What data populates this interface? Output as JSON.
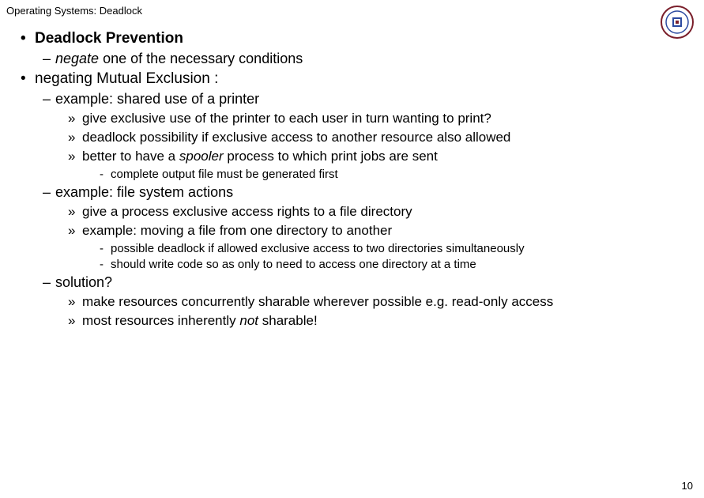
{
  "header": "Operating Systems: Deadlock",
  "slide": {
    "l1a": "Deadlock Prevention",
    "l2a_pre": "negate",
    "l2a_post": " one of the necessary conditions",
    "l1b": "negating Mutual Exclusion :",
    "l2b": "example: shared use of a printer",
    "l3a": "give exclusive use of the printer to each user in turn wanting to print?",
    "l3b": "deadlock possibility if exclusive access to another resource also allowed",
    "l3c_pre": "better to have a ",
    "l3c_it": "spooler",
    "l3c_post": " process to which print jobs are sent",
    "l4a": "complete output file must be generated first",
    "l2c": "example: file system actions",
    "l3d": "give a process exclusive access rights to a file directory",
    "l3e": "example: moving a file from one directory to another",
    "l4b": "possible deadlock if allowed exclusive access to two directories simultaneously",
    "l4c": "should write code so as only to need to access one directory at a time",
    "l2d": "solution?",
    "l3f": "make resources concurrently sharable wherever possible e.g. read-only access",
    "l3g_pre": "most resources inherently ",
    "l3g_it": "not",
    "l3g_post": " sharable!"
  },
  "page_number": "10"
}
